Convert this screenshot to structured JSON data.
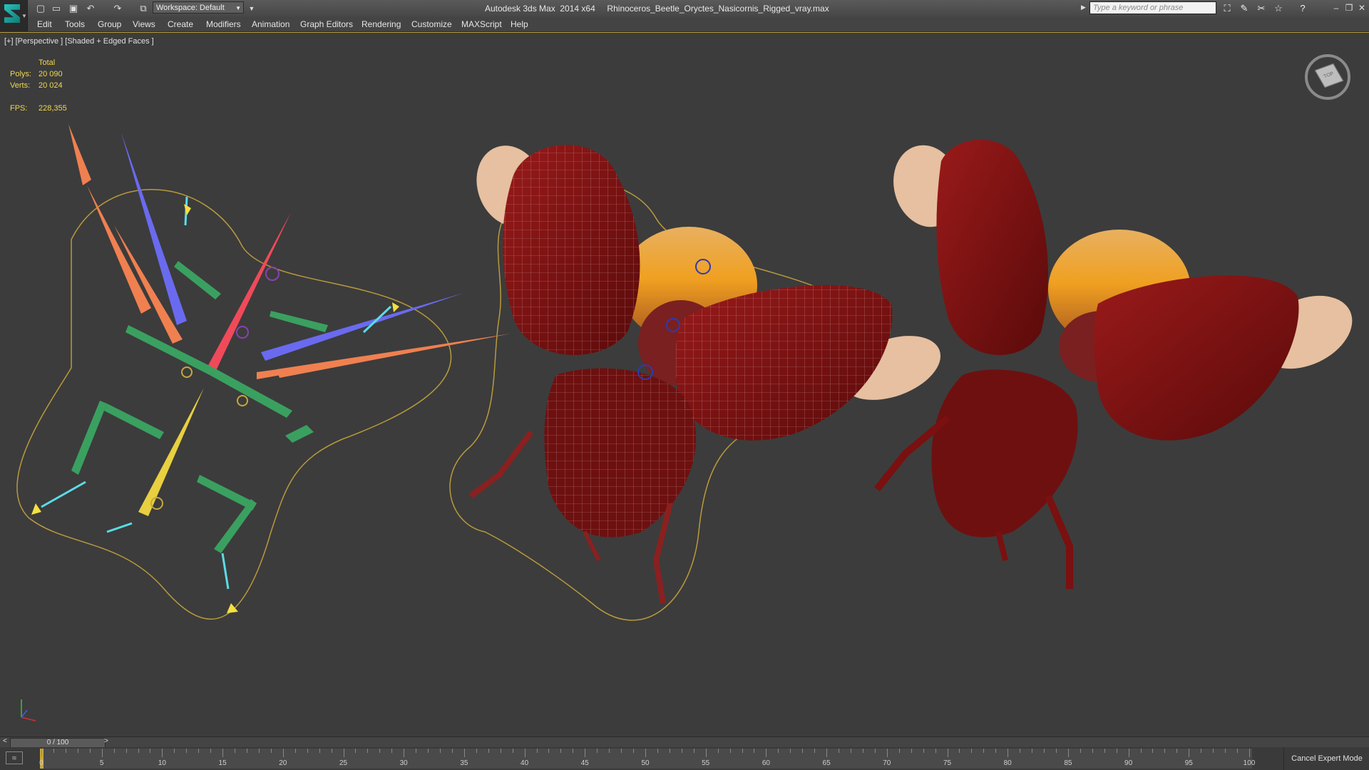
{
  "titlebar": {
    "workspace": "Workspace: Default",
    "title": "Autodesk 3ds Max  2014 x64     Rhinoceros_Beetle_Oryctes_Nasicornis_Rigged_vray.max",
    "search_placeholder": "Type a keyword or phrase"
  },
  "menu": [
    "Edit",
    "Tools",
    "Group",
    "Views",
    "Create",
    "Modifiers",
    "Animation",
    "Graph Editors",
    "Rendering",
    "Customize",
    "MAXScript",
    "Help"
  ],
  "viewport": {
    "label": "[+] [Perspective ] [Shaded + Edged Faces ]",
    "stats": {
      "total_label": "Total",
      "polys_label": "Polys:",
      "polys": "20 090",
      "verts_label": "Verts:",
      "verts": "20 024",
      "fps_label": "FPS:",
      "fps": "228,355"
    },
    "viewcube_face": "TOP"
  },
  "timeline": {
    "slider": "0 / 100",
    "ticks": [
      "0",
      "5",
      "10",
      "15",
      "20",
      "25",
      "30",
      "35",
      "40",
      "45",
      "50",
      "55",
      "60",
      "65",
      "70",
      "75",
      "80",
      "85",
      "90",
      "95",
      "100"
    ],
    "prev": "<",
    "next": ">"
  },
  "status": {
    "cancel_expert": "Cancel Expert Mode"
  },
  "colors": {
    "viewport_bg": "#3c3c3c",
    "selection_outline": "#b89a3c",
    "stats_text": "#f0d850",
    "beetle_red": "#8a1212"
  }
}
